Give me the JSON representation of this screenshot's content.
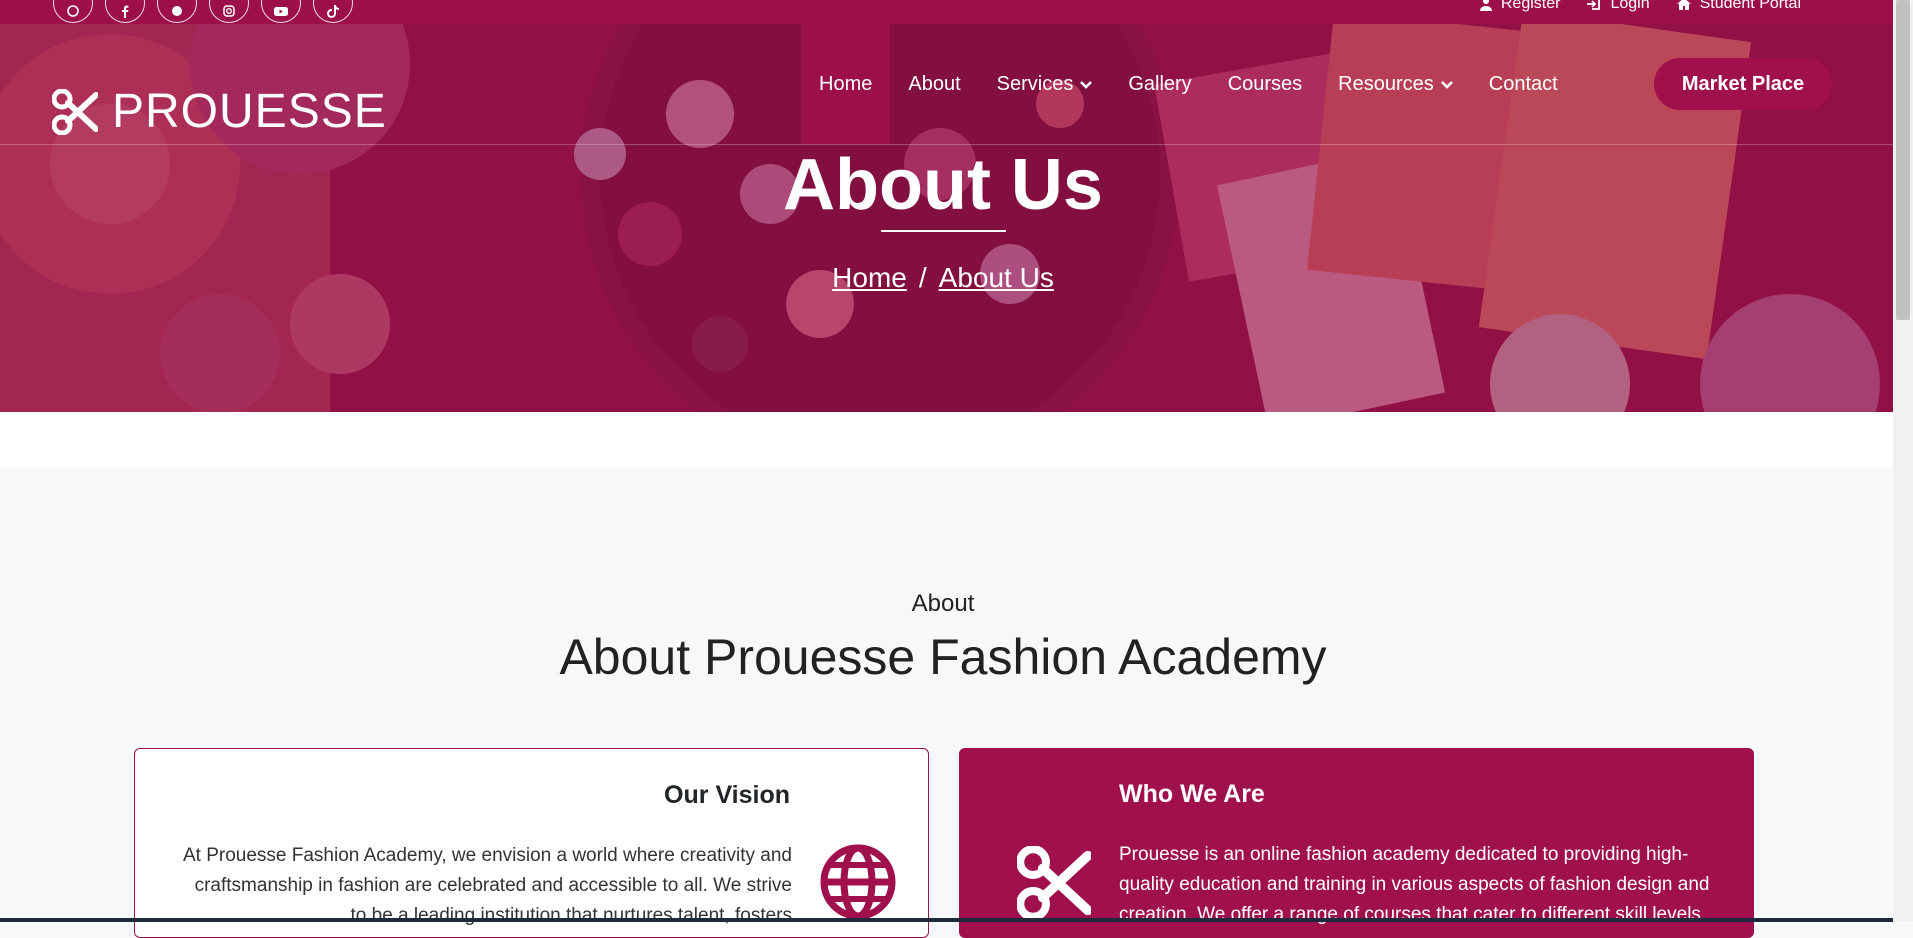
{
  "topbar": {
    "socials": [
      "skype-icon",
      "facebook-icon",
      "pinterest-icon",
      "instagram-icon",
      "youtube-icon",
      "tiktok-icon"
    ],
    "links": [
      {
        "label": "Register",
        "icon": "user-icon"
      },
      {
        "label": "Login",
        "icon": "login-icon"
      },
      {
        "label": "Student Portal",
        "icon": "home-icon"
      }
    ]
  },
  "brand": {
    "name": "PROUESSE",
    "icon": "scissors-icon"
  },
  "nav": {
    "items": [
      {
        "label": "Home",
        "active": true,
        "dropdown": false
      },
      {
        "label": "About",
        "active": false,
        "dropdown": false
      },
      {
        "label": "Services",
        "active": false,
        "dropdown": true
      },
      {
        "label": "Gallery",
        "active": false,
        "dropdown": false
      },
      {
        "label": "Courses",
        "active": false,
        "dropdown": false
      },
      {
        "label": "Resources",
        "active": false,
        "dropdown": true
      },
      {
        "label": "Contact",
        "active": false,
        "dropdown": false
      }
    ],
    "cta": "Market Place"
  },
  "hero": {
    "title": "About Us",
    "breadcrumb": {
      "home": "Home",
      "separator": "/",
      "current": "About Us"
    }
  },
  "about": {
    "kicker": "About",
    "heading": "About Prouesse Fashion Academy",
    "vision": {
      "title": "Our Vision",
      "text": "At Prouesse Fashion Academy, we envision a world where creativity and craftsmanship in fashion are celebrated and accessible to all. We strive to be a leading institution that nurtures talent, fosters",
      "icon": "globe-icon"
    },
    "who": {
      "title": "Who We Are",
      "text": "Prouesse is an online fashion academy dedicated to providing high-quality education and training in various aspects of fashion design and creation. We offer a range of courses that cater to different skill levels",
      "icon": "scissors-icon"
    }
  },
  "colors": {
    "brand": "#9c0f4b",
    "accent": "#a0104d",
    "background": "#f7f8fa"
  }
}
